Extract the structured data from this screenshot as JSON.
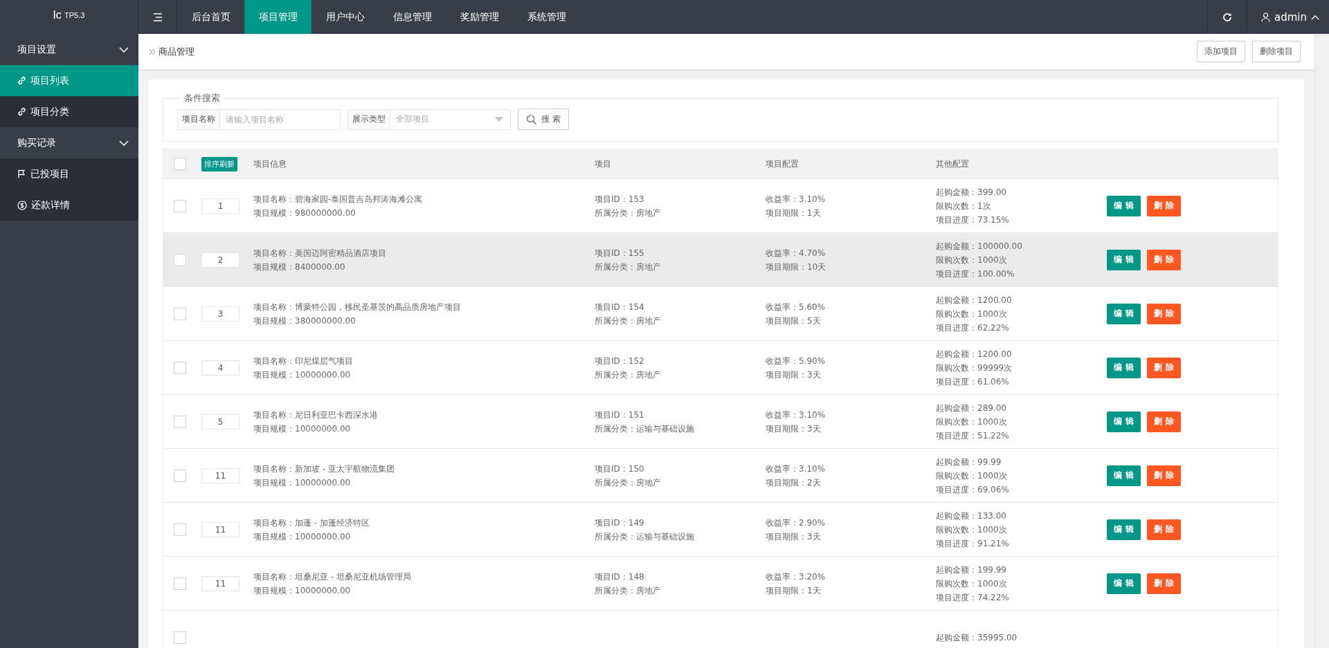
{
  "logo": {
    "text": "lc",
    "version": "TP5.3"
  },
  "top_nav": {
    "tabs": [
      {
        "label": "后台首页",
        "selected": false
      },
      {
        "label": "项目管理",
        "selected": true
      },
      {
        "label": "用户中心",
        "selected": false
      },
      {
        "label": "信息管理",
        "selected": false
      },
      {
        "label": "奖励管理",
        "selected": false
      },
      {
        "label": "系统管理",
        "selected": false
      }
    ],
    "user": "admin"
  },
  "sidebar": {
    "groups": [
      {
        "label": "项目设置",
        "expanded": true,
        "items": [
          {
            "kind": "link",
            "label": "项目列表",
            "selected": true
          },
          {
            "kind": "link",
            "label": "项目分类",
            "selected": false
          }
        ]
      },
      {
        "label": "购买记录",
        "expanded": true,
        "items": [
          {
            "kind": "flag",
            "label": "已投项目",
            "selected": false
          },
          {
            "kind": "dollar",
            "label": "还款详情",
            "selected": false
          }
        ]
      }
    ]
  },
  "breadcrumb": "商品管理",
  "actions": [
    "添加项目",
    "删除项目"
  ],
  "search": {
    "legend": "条件搜索",
    "fields": [
      {
        "kind": "text",
        "label": "项目名称",
        "placeholder": "请输入项目名称"
      },
      {
        "kind": "select",
        "label": "展示类型",
        "value": "全部项目"
      }
    ],
    "button": "搜 索"
  },
  "table": {
    "header_checked": false,
    "sort_button": "排序刷新",
    "columns": [
      "项目信息",
      "项目",
      "项目配置",
      "其他配置"
    ],
    "rows": [
      {
        "checked": false,
        "hovered": false,
        "sort": "1",
        "info": [
          "项目名称：碧海家园-泰国普吉岛邦涛海滩公寓",
          "项目规模：980000000.00"
        ],
        "id": [
          "项目ID：153",
          "所属分类：房地产"
        ],
        "config": [
          "收益率：3.10%",
          "项目期限：1天"
        ],
        "other": [
          "起购金额：399.00",
          "限购次数：1次",
          "项目进度：73.15%"
        ],
        "actions": [
          "编 辑",
          "删 除"
        ]
      },
      {
        "checked": false,
        "hovered": true,
        "sort": "2",
        "info": [
          "项目名称：美国迈阿密精品酒店项目",
          "项目规模：8400000.00"
        ],
        "id": [
          "项目ID：155",
          "所属分类：房地产"
        ],
        "config": [
          "收益率：4.70%",
          "项目期限：10天"
        ],
        "other": [
          "起购金额：100000.00",
          "限购次数：1000次",
          "项目进度：100.00%"
        ],
        "actions": [
          "编 辑",
          "删 除"
        ]
      },
      {
        "checked": false,
        "hovered": false,
        "sort": "3",
        "info": [
          "项目名称：博蒙特公园，移民圣基茨的高品质房地产项目",
          "项目规模：380000000.00"
        ],
        "id": [
          "项目ID：154",
          "所属分类：房地产"
        ],
        "config": [
          "收益率：5.60%",
          "项目期限：5天"
        ],
        "other": [
          "起购金额：1200.00",
          "限购次数：1000次",
          "项目进度：62.22%"
        ],
        "actions": [
          "编 辑",
          "删 除"
        ]
      },
      {
        "checked": false,
        "hovered": false,
        "sort": "4",
        "info": [
          "项目名称：印尼煤层气项目",
          "项目规模：10000000.00"
        ],
        "id": [
          "项目ID：152",
          "所属分类：房地产"
        ],
        "config": [
          "收益率：5.90%",
          "项目期限：3天"
        ],
        "other": [
          "起购金额：1200.00",
          "限购次数：99999次",
          "项目进度：61.06%"
        ],
        "actions": [
          "编 辑",
          "删 除"
        ]
      },
      {
        "checked": false,
        "hovered": false,
        "sort": "5",
        "info": [
          "项目名称：尼日利亚巴卡西深水港",
          "项目规模：10000000.00"
        ],
        "id": [
          "项目ID：151",
          "所属分类：运输与基础设施"
        ],
        "config": [
          "收益率：3.10%",
          "项目期限：3天"
        ],
        "other": [
          "起购金额：289.00",
          "限购次数：1000次",
          "项目进度：51.22%"
        ],
        "actions": [
          "编 辑",
          "删 除"
        ]
      },
      {
        "checked": false,
        "hovered": false,
        "sort": "11",
        "info": [
          "项目名称：新加坡 - 亚太宇航物流集团",
          "项目规模：10000000.00"
        ],
        "id": [
          "项目ID：150",
          "所属分类：房地产"
        ],
        "config": [
          "收益率：3.10%",
          "项目期限：2天"
        ],
        "other": [
          "起购金额：99.99",
          "限购次数：1000次",
          "项目进度：69.06%"
        ],
        "actions": [
          "编 辑",
          "删 除"
        ]
      },
      {
        "checked": false,
        "hovered": false,
        "sort": "11",
        "info": [
          "项目名称：加蓬 - 加蓬经济特区",
          "项目规模：10000000.00"
        ],
        "id": [
          "项目ID：149",
          "所属分类：运输与基础设施"
        ],
        "config": [
          "收益率：2.90%",
          "项目期限：3天"
        ],
        "other": [
          "起购金额：133.00",
          "限购次数：1000次",
          "项目进度：91.21%"
        ],
        "actions": [
          "编 辑",
          "删 除"
        ]
      },
      {
        "checked": false,
        "hovered": false,
        "sort": "11",
        "info": [
          "项目名称：坦桑尼亚 - 坦桑尼亚机场管理局",
          "项目规模：10000000.00"
        ],
        "id": [
          "项目ID：148",
          "所属分类：房地产"
        ],
        "config": [
          "收益率：3.20%",
          "项目期限：1天"
        ],
        "other": [
          "起购金额：199.99",
          "限购次数：1000次",
          "项目进度：74.22%"
        ],
        "actions": [
          "编 辑",
          "删 除"
        ]
      },
      {
        "checked": false,
        "hovered": false,
        "other": [
          "起购金额：35995.00"
        ]
      }
    ]
  }
}
